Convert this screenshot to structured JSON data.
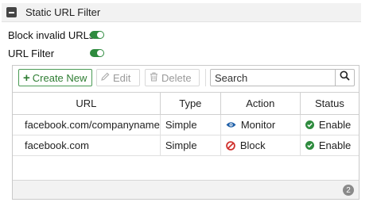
{
  "section": {
    "title": "Static URL Filter"
  },
  "settings": [
    {
      "label": "Block invalid URLs",
      "enabled": true
    },
    {
      "label": "URL Filter",
      "enabled": true
    }
  ],
  "toolbar": {
    "create_label": "Create New",
    "edit_label": "Edit",
    "delete_label": "Delete",
    "search_placeholder": "Search"
  },
  "table": {
    "columns": [
      "URL",
      "Type",
      "Action",
      "Status"
    ],
    "rows": [
      {
        "url": "facebook.com/companyname",
        "type": "Simple",
        "action": "Monitor",
        "action_icon": "eye-icon",
        "status": "Enable",
        "status_icon": "check-circle-icon"
      },
      {
        "url": "facebook.com",
        "type": "Simple",
        "action": "Block",
        "action_icon": "block-icon",
        "status": "Enable",
        "status_icon": "check-circle-icon"
      }
    ]
  },
  "footer": {
    "count": "2"
  },
  "colors": {
    "accent_green": "#2e8b3e",
    "monitor_blue": "#1f5fa8",
    "block_red": "#d0312d"
  }
}
